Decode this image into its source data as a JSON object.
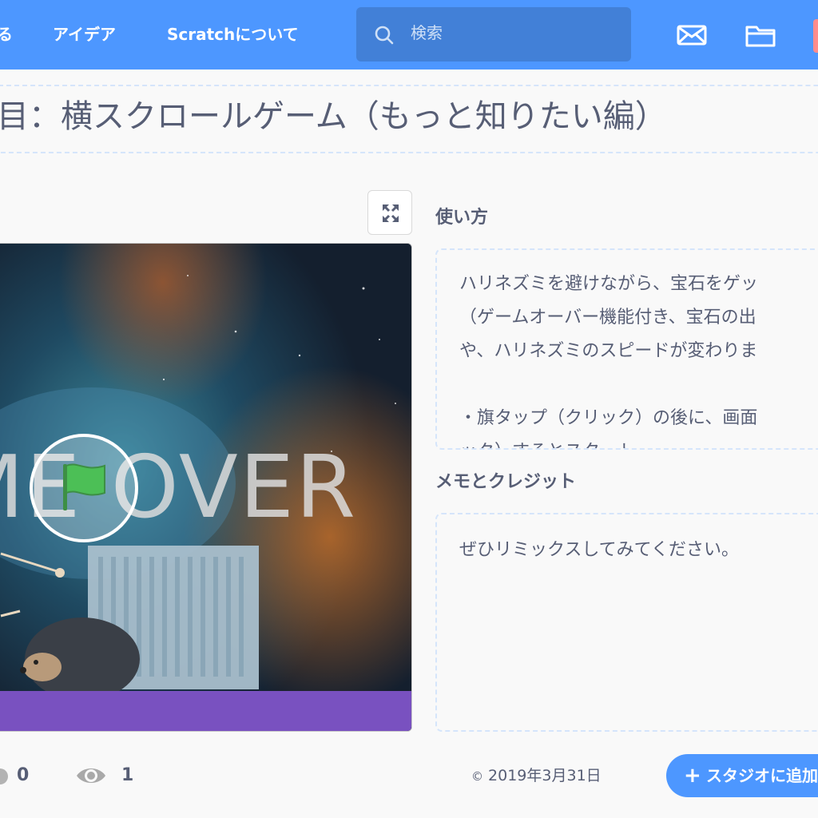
{
  "nav": {
    "create_partial": "る",
    "ideas": "アイデア",
    "about": "Scratchについて",
    "search_placeholder": "検索",
    "messages_icon": "mail-icon",
    "mystuff_icon": "folder-icon"
  },
  "project": {
    "title": "目：横スクロールゲーム（もっと知りたい編）",
    "stage_text": "ME OVER"
  },
  "instructions": {
    "label": "使い方",
    "lines": [
      "ハリネズミを避けながら、宝石をゲッ",
      "（ゲームオーバー機能付き、宝石の出",
      "や、ハリネズミのスピードが変わりま",
      "",
      "・旗タップ（クリック）の後に、画面",
      "ック）するとスタート"
    ]
  },
  "notes": {
    "label": "メモとクレジット",
    "lines": [
      "ぜひリミックスしてみてください。"
    ]
  },
  "stats": {
    "remix_count": "0",
    "view_count": "1"
  },
  "footer": {
    "date": "2019年3月31日",
    "add_to_studio": "スタジオに追加"
  },
  "colors": {
    "nav": "#4d97ff",
    "search": "#4280d7",
    "stage_bar": "#7951c0",
    "text": "#575e75",
    "flag": "#4cbf56"
  }
}
